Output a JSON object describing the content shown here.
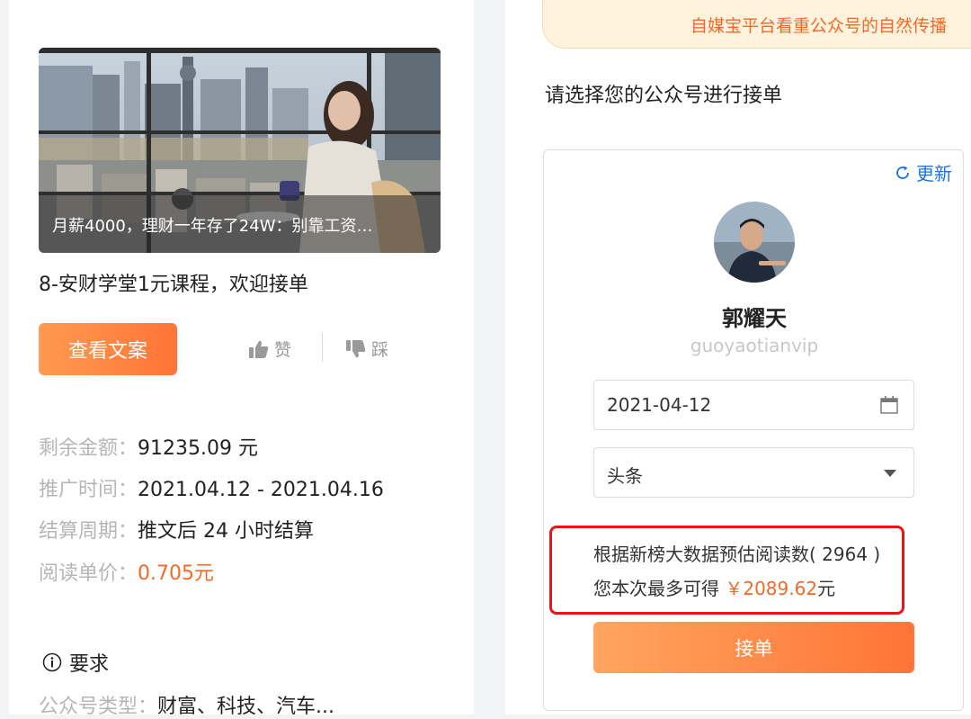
{
  "banner": {
    "text": "自媒宝平台看重公众号的自然传播"
  },
  "course": {
    "cover_caption": "月薪4000，理财一年存了24W：别靠工资…",
    "title": "8-安财学堂1元课程，欢迎接单",
    "view_copy_label": "查看文案",
    "like_label": "赞",
    "dislike_label": "踩",
    "details": [
      {
        "label": "剩余金额：",
        "value": "91235.09 元",
        "highlight": false
      },
      {
        "label": "推广时间：",
        "value": "2021.04.12 - 2021.04.16",
        "highlight": false
      },
      {
        "label": "结算周期：",
        "value": "推文后 24 小时结算",
        "highlight": false
      },
      {
        "label": "阅读单价：",
        "value": "0.705元",
        "highlight": true
      }
    ],
    "requirements_heading": "要求",
    "requirement": {
      "label": "公众号类型：",
      "value": "财富、科技、汽车..."
    }
  },
  "account_select": {
    "prompt": "请选择您的公众号进行接单",
    "refresh_label": "更新",
    "account_name": "郭耀天",
    "account_id": "guoyaotianvip",
    "date_value": "2021-04-12",
    "position_value": "头条",
    "estimate_line1": "根据新榜大数据预估阅读数( 2964 )",
    "estimate_prefix": "您本次最多可得",
    "estimate_amount": "￥2089.62",
    "estimate_suffix": "元",
    "accept_label": "接单"
  },
  "colors": {
    "accent_orange": "#f26a28",
    "button_orange_start": "#ff9a50",
    "button_orange_end": "#ff7438",
    "link_blue": "#1a73e8",
    "highlight_red": "#e8161a",
    "banner_bg": "#fff3de"
  },
  "icons": {
    "like": "thumbs-up-icon",
    "dislike": "thumbs-down-icon",
    "info": "info-circle-icon",
    "refresh": "refresh-icon",
    "calendar": "calendar-icon",
    "dropdown": "caret-down-icon"
  }
}
